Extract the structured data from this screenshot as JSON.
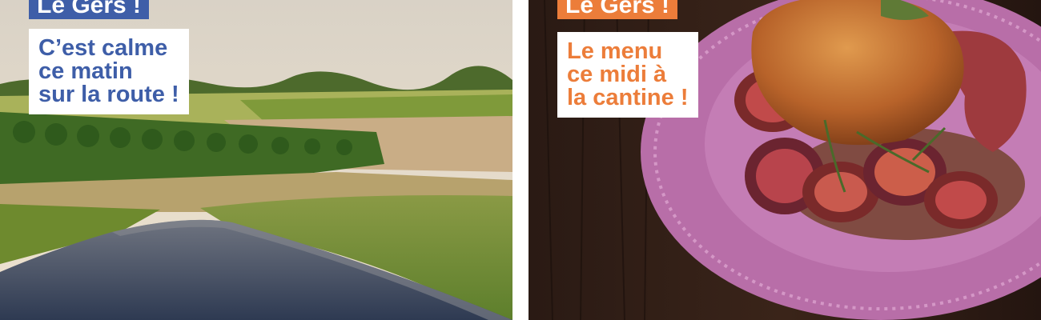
{
  "left_panel": {
    "tag": "Le Gers !",
    "caption_lines": [
      "C’est calme",
      "ce matin",
      "sur la route !"
    ]
  },
  "right_panel": {
    "tag": "Le Gers !",
    "caption_lines": [
      "Le menu",
      "ce midi à",
      "la cantine !"
    ]
  },
  "colors": {
    "blue_accent": "#3e5ea8",
    "orange_accent": "#ec7d3a",
    "background": "#ffffff"
  }
}
